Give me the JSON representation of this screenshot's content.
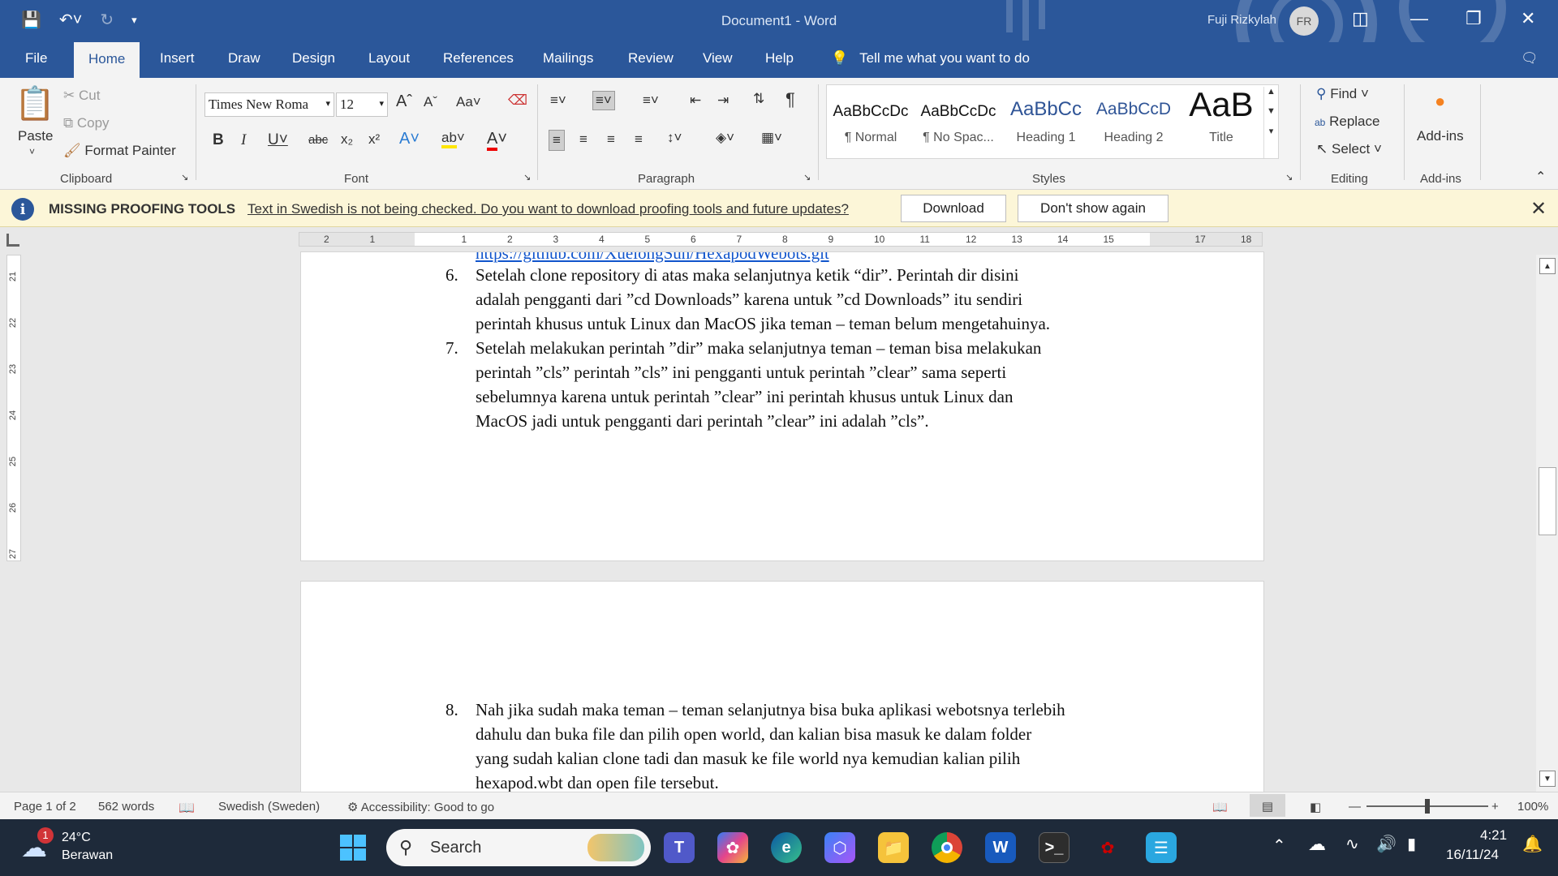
{
  "window": {
    "title": "Document1  -  Word",
    "user_name": "Fuji Rizkylah",
    "user_initials": "FR"
  },
  "tabs": [
    "File",
    "Home",
    "Insert",
    "Draw",
    "Design",
    "Layout",
    "References",
    "Mailings",
    "Review",
    "View",
    "Help"
  ],
  "tell_me": "Tell me what you want to do",
  "ribbon": {
    "clipboard": {
      "paste": "Paste",
      "cut": "Cut",
      "copy": "Copy",
      "format_painter": "Format Painter",
      "label": "Clipboard"
    },
    "font": {
      "name": "Times New Roma",
      "size": "12",
      "label": "Font",
      "change_case": "Aa"
    },
    "paragraph": {
      "label": "Paragraph"
    },
    "styles": {
      "label": "Styles",
      "items": [
        {
          "sample": "AaBbCcDc",
          "name": "¶ Normal"
        },
        {
          "sample": "AaBbCcDc",
          "name": "¶ No Spac..."
        },
        {
          "sample": "AaBbCc",
          "name": "Heading 1"
        },
        {
          "sample": "AaBbCcD",
          "name": "Heading 2"
        },
        {
          "sample": "AaB",
          "name": "Title"
        }
      ]
    },
    "editing": {
      "find": "Find",
      "replace": "Replace",
      "select": "Select",
      "label": "Editing"
    },
    "addins": {
      "button": "Add-ins",
      "label": "Add-ins"
    }
  },
  "infobar": {
    "title": "MISSING PROOFING TOOLS",
    "message": "Text in Swedish is not being checked. Do you want to download proofing tools and future updates?",
    "download": "Download",
    "dont_show": "Don't show again"
  },
  "ruler": {
    "h_labels": [
      "2",
      "1",
      "1",
      "2",
      "3",
      "4",
      "5",
      "6",
      "7",
      "8",
      "9",
      "10",
      "11",
      "12",
      "13",
      "14",
      "15",
      "17",
      "18"
    ],
    "v_labels": [
      "21",
      "22",
      "23",
      "24",
      "25",
      "26",
      "27"
    ]
  },
  "document": {
    "link_fragment": "https://github.com/XuelongSun/HexapodWebots.git",
    "items": [
      {
        "num": "6.",
        "lines": [
          "Setelah clone repository di atas maka selanjutnya ketik “dir”. Perintah dir disini",
          "adalah pengganti dari ”cd Downloads” karena untuk ”cd Downloads” itu sendiri",
          "perintah khusus untuk Linux dan MacOS jika teman – teman belum mengetahuinya."
        ]
      },
      {
        "num": "7.",
        "lines": [
          "Setelah melakukan perintah ”dir” maka selanjutnya teman – teman bisa melakukan",
          "perintah ”cls” perintah ”cls” ini pengganti untuk perintah ”clear” sama seperti",
          "sebelumnya karena untuk perintah ”clear” ini perintah khusus untuk Linux dan",
          "MacOS jadi untuk pengganti dari perintah ”clear” ini adalah ”cls”."
        ]
      },
      {
        "num": "8.",
        "lines": [
          "Nah jika sudah maka teman – teman selanjutnya bisa buka aplikasi webotsnya terlebih",
          "dahulu dan buka file dan pilih open world, dan kalian bisa masuk ke dalam folder",
          "yang sudah kalian clone tadi dan masuk ke file world nya kemudian kalian pilih",
          "hexapod.wbt dan open file tersebut."
        ]
      }
    ]
  },
  "status": {
    "page": "Page 1 of 2",
    "words": "562 words",
    "language": "Swedish (Sweden)",
    "accessibility": "Accessibility: Good to go",
    "zoom": "100%",
    "zoom_level": 100
  },
  "taskbar": {
    "weather_temp": "24°C",
    "weather_desc": "Berawan",
    "weather_badge": "1",
    "search": "Search",
    "time": "4:21",
    "date": "16/11/24"
  },
  "colors": {
    "word_blue": "#2b579a",
    "infobar": "#fcf6d8",
    "link": "#1155cc"
  }
}
